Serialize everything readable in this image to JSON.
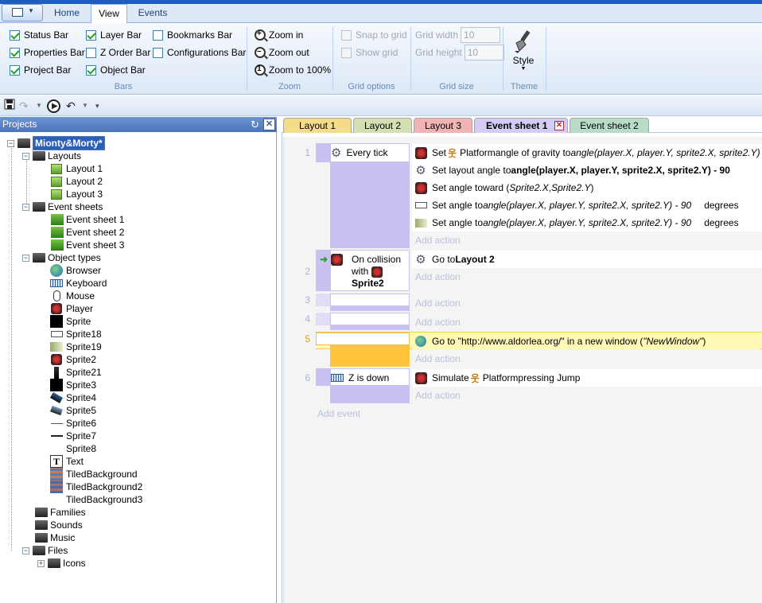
{
  "ribbon": {
    "tabs": [
      "Home",
      "View",
      "Events"
    ],
    "active_tab": "View",
    "bars_group": {
      "label": "Bars",
      "items": [
        {
          "label": "Status Bar",
          "checked": true
        },
        {
          "label": "Properties Bar",
          "checked": true
        },
        {
          "label": "Project Bar",
          "checked": true
        },
        {
          "label": "Layer Bar",
          "checked": true
        },
        {
          "label": "Z Order Bar",
          "checked": false
        },
        {
          "label": "Object Bar",
          "checked": true
        },
        {
          "label": "Bookmarks Bar",
          "checked": false
        },
        {
          "label": "Configurations Bar",
          "checked": false
        }
      ]
    },
    "zoom_group": {
      "label": "Zoom",
      "zoom_in": "Zoom in",
      "zoom_out": "Zoom out",
      "zoom_100": "Zoom to 100%"
    },
    "grid_options_group": {
      "label": "Grid options",
      "snap": "Snap to grid",
      "show": "Show grid"
    },
    "grid_size_group": {
      "label": "Grid size",
      "width_label": "Grid width",
      "width_value": "10",
      "height_label": "Grid height",
      "height_value": "10"
    },
    "theme_group": {
      "label": "Theme",
      "style": "Style"
    }
  },
  "projects": {
    "header": "Projects",
    "root": "Mionty&Morty*",
    "layouts_label": "Layouts",
    "layouts": [
      "Layout 1",
      "Layout 2",
      "Layout 3"
    ],
    "event_sheets_label": "Event sheets",
    "event_sheets": [
      "Event sheet 1",
      "Event sheet 2",
      "Event sheet 3"
    ],
    "object_types_label": "Object types",
    "object_types": [
      "Browser",
      "Keyboard",
      "Mouse",
      "Player",
      "Sprite",
      "Sprite18",
      "Sprite19",
      "Sprite2",
      "Sprite21",
      "Sprite3",
      "Sprite4",
      "Sprite5",
      "Sprite6",
      "Sprite7",
      "Sprite8",
      "Text",
      "TiledBackground",
      "TiledBackground2",
      "TiledBackground3"
    ],
    "families": "Families",
    "sounds": "Sounds",
    "music": "Music",
    "files": "Files",
    "icons": "Icons"
  },
  "doc_tabs": [
    {
      "label": "Layout 1",
      "color": "#f5dc8a"
    },
    {
      "label": "Layout 2",
      "color": "#d4e0b4"
    },
    {
      "label": "Layout 3",
      "color": "#f0b4b4"
    },
    {
      "label": "Event sheet 1",
      "color": "#d4ccf4",
      "active": true
    },
    {
      "label": "Event sheet 2",
      "color": "#b8dcc8"
    }
  ],
  "events": {
    "e1": {
      "num": "1",
      "condition": "Every tick",
      "actions": {
        "a1": {
          "p1": "Set ",
          "obj": "Platform",
          "p2": " angle of gravity to ",
          "expr": "angle(player.X, player.Y, sprite2.X, sprite2.Y)"
        },
        "a2": {
          "p1": "Set layout angle to ",
          "expr": "angle(player.X, player.Y, sprite2.X, sprite2.Y) - 90"
        },
        "a3": {
          "p1": "Set angle toward (",
          "expr": "Sprite2.X",
          "p2": ", ",
          "expr2": "Sprite2.Y",
          "p3": ")"
        },
        "a4": {
          "p1": "Set angle to ",
          "expr": "angle(player.X, player.Y, sprite2.X, sprite2.Y) - 90",
          "unit": "degrees"
        },
        "a5": {
          "p1": "Set angle to ",
          "expr": "angle(player.X, player.Y, sprite2.X, sprite2.Y) - 90",
          "unit": "degrees"
        }
      }
    },
    "e2": {
      "num": "2",
      "cond1": "On collision",
      "cond2": "with",
      "cond3": "Sprite2",
      "action_p1": "Go to ",
      "action_b": "Layout 2"
    },
    "e3": {
      "num": "3"
    },
    "e4": {
      "num": "4"
    },
    "e5": {
      "num": "5",
      "action": "Go to \"http://www.aldorlea.org/\" in a new window (",
      "action_it": "\"NewWindow\"",
      "action_end": ")"
    },
    "e6": {
      "num": "6",
      "condition": "Z is down",
      "p1": "Simulate ",
      "obj": "Platform",
      "p2": " pressing Jump"
    },
    "add_action": "Add action",
    "add_event": "Add event"
  }
}
